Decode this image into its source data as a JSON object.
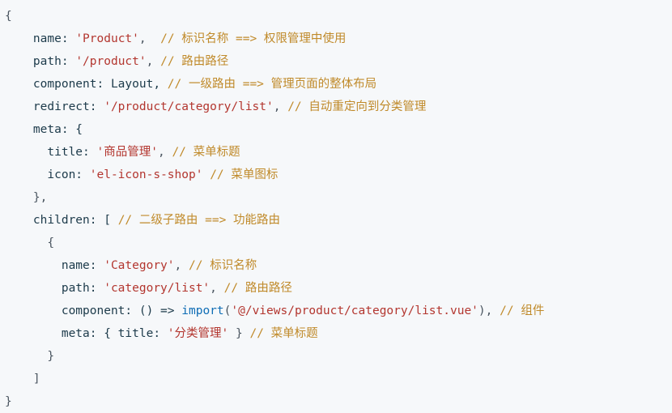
{
  "lines": [
    [
      {
        "t": "{",
        "c": "p"
      }
    ],
    [
      {
        "t": "    name: ",
        "c": "k"
      },
      {
        "t": "'Product'",
        "c": "s"
      },
      {
        "t": ",  ",
        "c": "p"
      },
      {
        "t": "// 标识名称 ==> 权限管理中使用",
        "c": "c"
      }
    ],
    [
      {
        "t": "    path: ",
        "c": "k"
      },
      {
        "t": "'/product'",
        "c": "s"
      },
      {
        "t": ", ",
        "c": "p"
      },
      {
        "t": "// 路由路径",
        "c": "c"
      }
    ],
    [
      {
        "t": "    component: Layout, ",
        "c": "k"
      },
      {
        "t": "// 一级路由 ==> 管理页面的整体布局",
        "c": "c"
      }
    ],
    [
      {
        "t": "    redirect: ",
        "c": "k"
      },
      {
        "t": "'/product/category/list'",
        "c": "s"
      },
      {
        "t": ", ",
        "c": "p"
      },
      {
        "t": "// 自动重定向到分类管理",
        "c": "c"
      }
    ],
    [
      {
        "t": "    meta: {",
        "c": "k"
      }
    ],
    [
      {
        "t": "      title: ",
        "c": "k"
      },
      {
        "t": "'商品管理'",
        "c": "s"
      },
      {
        "t": ", ",
        "c": "p"
      },
      {
        "t": "// 菜单标题",
        "c": "c"
      }
    ],
    [
      {
        "t": "      icon: ",
        "c": "k"
      },
      {
        "t": "'el-icon-s-shop'",
        "c": "s"
      },
      {
        "t": " ",
        "c": "p"
      },
      {
        "t": "// 菜单图标",
        "c": "c"
      }
    ],
    [
      {
        "t": "    },",
        "c": "p"
      }
    ],
    [
      {
        "t": "    children: [ ",
        "c": "k"
      },
      {
        "t": "// 二级子路由 ==> 功能路由",
        "c": "c"
      }
    ],
    [
      {
        "t": "      {",
        "c": "p"
      }
    ],
    [
      {
        "t": "        name: ",
        "c": "k"
      },
      {
        "t": "'Category'",
        "c": "s"
      },
      {
        "t": ", ",
        "c": "p"
      },
      {
        "t": "// 标识名称",
        "c": "c"
      }
    ],
    [
      {
        "t": "        path: ",
        "c": "k"
      },
      {
        "t": "'category/list'",
        "c": "s"
      },
      {
        "t": ", ",
        "c": "p"
      },
      {
        "t": "// 路由路径",
        "c": "c"
      }
    ],
    [
      {
        "t": "        component: () => ",
        "c": "k"
      },
      {
        "t": "import",
        "c": "f"
      },
      {
        "t": "(",
        "c": "p"
      },
      {
        "t": "'@/views/product/category/list.vue'",
        "c": "s"
      },
      {
        "t": "), ",
        "c": "p"
      },
      {
        "t": "// 组件",
        "c": "c"
      }
    ],
    [
      {
        "t": "        meta: { title: ",
        "c": "k"
      },
      {
        "t": "'分类管理'",
        "c": "s"
      },
      {
        "t": " } ",
        "c": "p"
      },
      {
        "t": "// 菜单标题",
        "c": "c"
      }
    ],
    [
      {
        "t": "      }",
        "c": "p"
      }
    ],
    [
      {
        "t": "    ]",
        "c": "p"
      }
    ],
    [
      {
        "t": "}",
        "c": "p"
      }
    ]
  ]
}
